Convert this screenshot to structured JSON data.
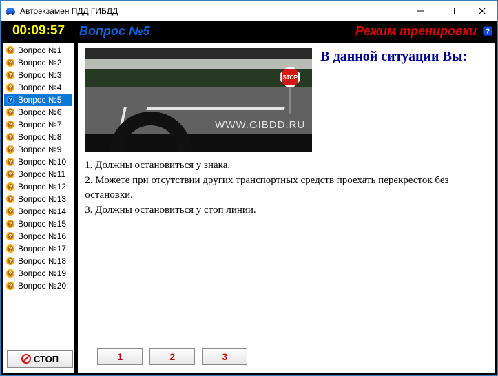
{
  "window": {
    "title": "Автоэкзамен ПДД ГИБДД"
  },
  "header": {
    "timer": "00:09:57",
    "question_title": "Вопрос №5",
    "mode_label": "Режим тренировки"
  },
  "colors": {
    "timer": "#ffff00",
    "question_link": "#1060d8",
    "mode_link": "#e00000",
    "answer_number": "#c00000",
    "prompt": "#000090"
  },
  "sidebar": {
    "selected_index": 4,
    "items": [
      {
        "label": "Вопрос №1"
      },
      {
        "label": "Вопрос №2"
      },
      {
        "label": "Вопрос №3"
      },
      {
        "label": "Вопрос №4"
      },
      {
        "label": "Вопрос №5"
      },
      {
        "label": "Вопрос №6"
      },
      {
        "label": "Вопрос №7"
      },
      {
        "label": "Вопрос №8"
      },
      {
        "label": "Вопрос №9"
      },
      {
        "label": "Вопрос №10"
      },
      {
        "label": "Вопрос №11"
      },
      {
        "label": "Вопрос №12"
      },
      {
        "label": "Вопрос №13"
      },
      {
        "label": "Вопрос №14"
      },
      {
        "label": "Вопрос №15"
      },
      {
        "label": "Вопрос №16"
      },
      {
        "label": "Вопрос №17"
      },
      {
        "label": "Вопрос №18"
      },
      {
        "label": "Вопрос №19"
      },
      {
        "label": "Вопрос №20"
      }
    ],
    "stop_label": "СТОП"
  },
  "question": {
    "prompt": "В данной ситуации Вы:",
    "image_watermark": "WWW.GIBDD.RU",
    "stop_sign_text": "STOP",
    "answers": [
      "1. Должны остановиться у знака.",
      "2. Можете при отсутствии других транспортных средств проехать перекресток без остановки.",
      "3. Должны остановиться у стоп линии."
    ],
    "answer_buttons": [
      "1",
      "2",
      "3"
    ]
  }
}
